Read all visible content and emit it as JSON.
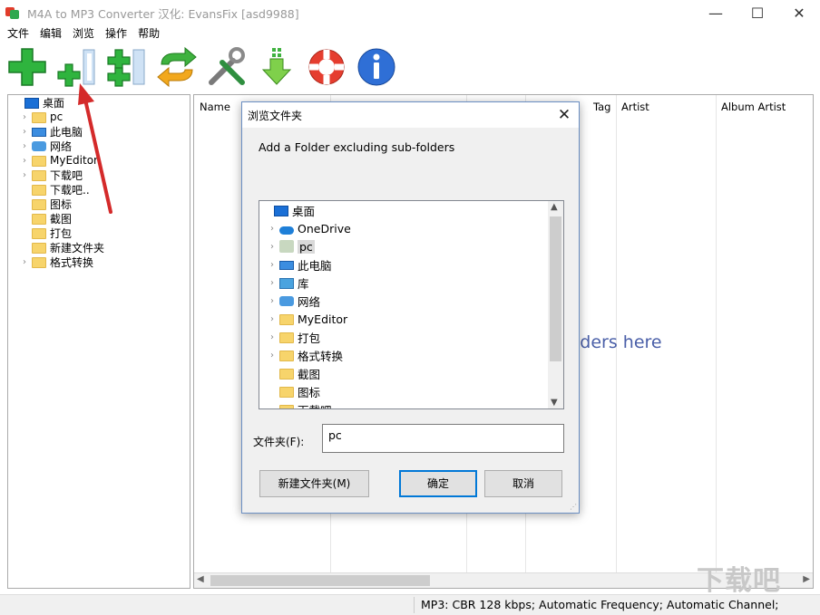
{
  "window": {
    "title": "M4A to MP3 Converter  汉化: EvansFix [asd9988]",
    "minimize": "—",
    "maximize": "☐",
    "close": "✕"
  },
  "menu": [
    "文件",
    "编辑",
    "浏览",
    "操作",
    "帮助"
  ],
  "toolbar": {
    "icons": [
      "add-files-icon",
      "add-folder-icon",
      "add-folder-subfolders-icon",
      "convert-icon",
      "settings-icon",
      "download-icon",
      "help-lifebuoy-icon",
      "info-icon"
    ]
  },
  "left_tree": [
    {
      "label": "桌面",
      "icon": "desktop",
      "expand": false,
      "indent": 0
    },
    {
      "label": "pc",
      "icon": "folder",
      "expand": true,
      "indent": 1
    },
    {
      "label": "此电脑",
      "icon": "pc",
      "expand": true,
      "indent": 1
    },
    {
      "label": "网络",
      "icon": "network",
      "expand": true,
      "indent": 1
    },
    {
      "label": "MyEditor",
      "icon": "folder",
      "expand": true,
      "indent": 1
    },
    {
      "label": "下载吧",
      "icon": "folder",
      "expand": true,
      "indent": 1
    },
    {
      "label": "下载吧..",
      "icon": "folder",
      "expand": false,
      "indent": 1
    },
    {
      "label": "图标",
      "icon": "folder",
      "expand": false,
      "indent": 1
    },
    {
      "label": "截图",
      "icon": "folder",
      "expand": false,
      "indent": 1
    },
    {
      "label": "打包",
      "icon": "folder",
      "expand": false,
      "indent": 1
    },
    {
      "label": "新建文件夹",
      "icon": "folder",
      "expand": false,
      "indent": 1
    },
    {
      "label": "格式转换",
      "icon": "folder",
      "expand": true,
      "indent": 1
    }
  ],
  "list": {
    "columns": {
      "name": "Name",
      "tag": "Tag",
      "artist": "Artist",
      "album_artist": "Album Artist"
    },
    "drop_hint": "lders here"
  },
  "status": "MP3:  CBR 128 kbps; Automatic Frequency; Automatic Channel;",
  "dialog": {
    "title": "浏览文件夹",
    "close": "✕",
    "description": "Add a Folder excluding sub-folders",
    "tree": [
      {
        "label": "桌面",
        "icon": "desktop",
        "expand": false,
        "indent": 0,
        "selected": false
      },
      {
        "label": "OneDrive",
        "icon": "cloud",
        "expand": true,
        "indent": 1,
        "selected": false
      },
      {
        "label": "pc",
        "icon": "user",
        "expand": true,
        "indent": 1,
        "selected": true
      },
      {
        "label": "此电脑",
        "icon": "pc",
        "expand": true,
        "indent": 1,
        "selected": false
      },
      {
        "label": "库",
        "icon": "library",
        "expand": true,
        "indent": 1,
        "selected": false
      },
      {
        "label": "网络",
        "icon": "network",
        "expand": true,
        "indent": 1,
        "selected": false
      },
      {
        "label": "MyEditor",
        "icon": "folder",
        "expand": true,
        "indent": 1,
        "selected": false
      },
      {
        "label": "打包",
        "icon": "folder",
        "expand": true,
        "indent": 1,
        "selected": false
      },
      {
        "label": "格式转换",
        "icon": "folder",
        "expand": true,
        "indent": 1,
        "selected": false
      },
      {
        "label": "截图",
        "icon": "folder",
        "expand": false,
        "indent": 1,
        "selected": false
      },
      {
        "label": "图标",
        "icon": "folder",
        "expand": false,
        "indent": 1,
        "selected": false
      },
      {
        "label": "下载吧",
        "icon": "folder",
        "expand": false,
        "indent": 1,
        "selected": false
      }
    ],
    "folder_label": "文件夹(F):",
    "folder_value": "pc",
    "new_folder_button": "新建文件夹(M)",
    "ok_button": "确定",
    "cancel_button": "取消"
  },
  "watermark": "下载吧",
  "colors": {
    "accent": "#0078d7",
    "hint": "#4a5fa8",
    "folder": "#f7d46b",
    "arrow": "#d42a2a"
  }
}
